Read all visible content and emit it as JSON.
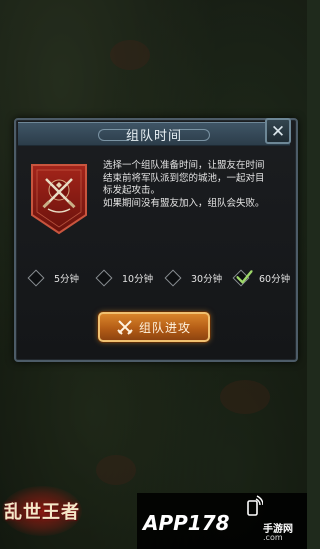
{
  "dialog": {
    "title": "组队时间",
    "close_glyph": "✕",
    "description": [
      "选择一个组队准备时间，让盟友在时间",
      "结束前将军队派到您的城池，一起对目",
      "标发起攻击。",
      "如果期间没有盟友加入，组队会失败。"
    ],
    "time_options": [
      {
        "label": "5分钟",
        "selected": false
      },
      {
        "label": "10分钟",
        "selected": false
      },
      {
        "label": "30分钟",
        "selected": false
      },
      {
        "label": "60分钟",
        "selected": true
      }
    ],
    "attack_button_label": "组队进攻"
  },
  "footer": {
    "game_logo": "乱世王者",
    "watermark_main": "APP178",
    "watermark_sub": "手游网",
    "watermark_url": ".com"
  },
  "colors": {
    "accent_orange": "#c46a1c",
    "banner_red": "#8a1a14",
    "dialog_border": "#4d5c68"
  },
  "icons": {
    "close": "close-icon",
    "emblem": "crossed-swords-banner-icon",
    "attack": "crossed-swords-icon",
    "check": "checkmark-icon"
  }
}
